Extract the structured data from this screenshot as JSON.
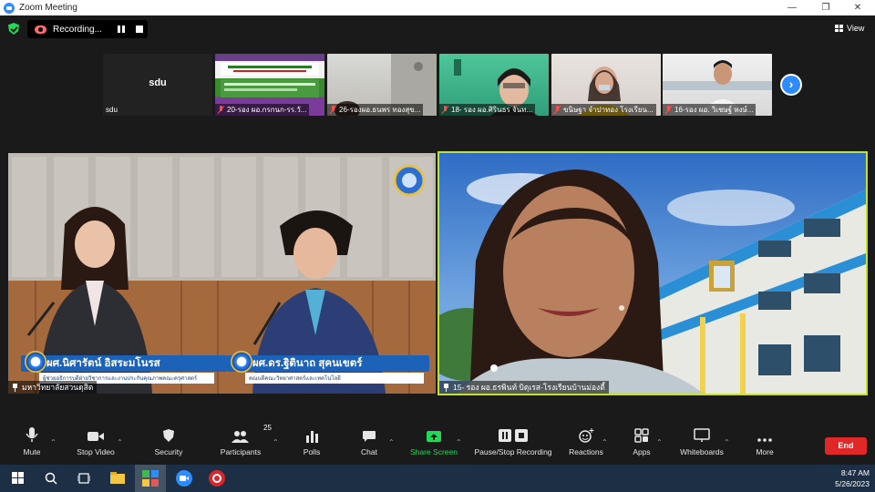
{
  "window": {
    "title": "Zoom Meeting"
  },
  "topbar": {
    "recording_label": "Recording...",
    "view_label": "View"
  },
  "thumbnails": [
    {
      "center_name": "sdu",
      "caption": "sdu",
      "muted": false
    },
    {
      "caption": "20-รอง ผอ.กรกนก-รร.วั...",
      "muted": true
    },
    {
      "caption": "26-รองผอ.ธนพร ทองสุข...",
      "muted": true
    },
    {
      "caption": "18- รอง ผอ.ศิรินธร จันท...",
      "muted": true
    },
    {
      "caption": "ขนิษฐา จำปาทอง โรงเรียน...",
      "muted": true
    },
    {
      "caption": "16-รอง ผอ. วิเชษฐ์ หงษ์...",
      "muted": true
    }
  ],
  "main_tiles": {
    "left": {
      "caption": "มหาวิทยาลัยสวนดุสิต",
      "plate1_name": "ผศ.นิศารัตน์ อิสระมโนรส",
      "plate1_sub": "ผู้ช่วยอธิการบดีฝ่ายวิชาการและงานประกันคุณภาพคณะครุศาสตร์",
      "plate2_name": "ผศ.ดร.ฐิตินาถ สุคนเขตร์",
      "plate2_sub": "คณบดีคณะวิทยาศาสตร์และเทคโนโลยี"
    },
    "right": {
      "caption": "15- รอง ผอ.ธรพินท์ บิตุเรส-โรงเรียนบ้านม่องตี้"
    }
  },
  "toolbar": {
    "mute": "Mute",
    "stop_video": "Stop Video",
    "security": "Security",
    "participants": "Participants",
    "participants_count": "25",
    "polls": "Polls",
    "chat": "Chat",
    "share_screen": "Share Screen",
    "pause_stop_recording": "Pause/Stop Recording",
    "reactions": "Reactions",
    "apps": "Apps",
    "whiteboards": "Whiteboards",
    "more": "More",
    "end": "End"
  },
  "taskbar": {
    "time": "8:47 AM",
    "date": "5/26/2023"
  },
  "colors": {
    "accent": "#2d8cff",
    "end": "#e02828",
    "share": "#23d959",
    "active_speaker": "#c6e02a"
  }
}
